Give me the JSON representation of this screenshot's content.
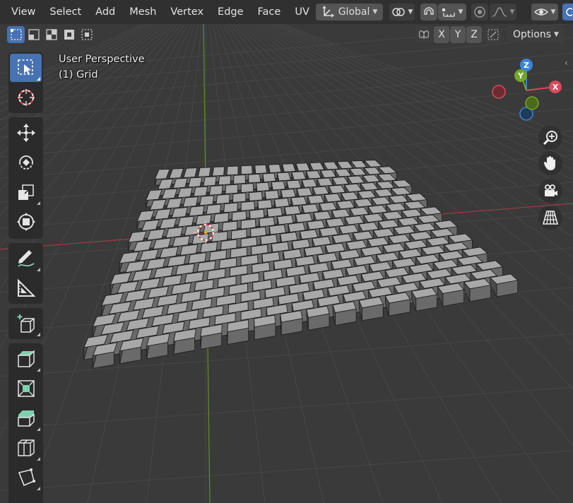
{
  "menu": [
    "View",
    "Select",
    "Add",
    "Mesh",
    "Vertex",
    "Edge",
    "Face",
    "UV"
  ],
  "header": {
    "orientation_label": "Global",
    "options_label": "Options",
    "axis_x": "X",
    "axis_y": "Y",
    "axis_z": "Z"
  },
  "viewport": {
    "view_name": "User Perspective",
    "object_info": "(1) Grid"
  },
  "gizmo": {
    "x": "X",
    "y": "Y",
    "z": "Z"
  },
  "colors": {
    "accent": "#4772b3",
    "axis_x": "#d94b5a",
    "axis_y": "#74a628",
    "axis_z": "#3b85d6",
    "mesh_face": "#a8a8a8",
    "background": "#3a3a3a"
  },
  "toolbar_tools": [
    "select-box-tool",
    "cursor-tool",
    "move-tool",
    "rotate-tool",
    "scale-tool",
    "transform-tool",
    "annotate-tool",
    "measure-tool",
    "add-cube-tool",
    "extrude-region-tool",
    "inset-faces-tool",
    "bevel-tool",
    "loop-cut-tool",
    "knife-tool"
  ]
}
